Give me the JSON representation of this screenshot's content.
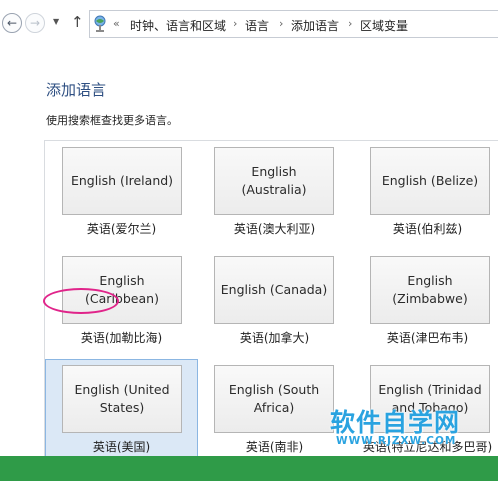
{
  "address_bar": {
    "overflow": "«",
    "crumbs": [
      "时钟、语言和区域",
      "语言",
      "添加语言",
      "区域变量"
    ],
    "separator": "›"
  },
  "page": {
    "title": "添加语言",
    "hint": "使用搜索框查找更多语言。"
  },
  "languages": [
    {
      "label": "English (Ireland)",
      "native": "英语(爱尔兰)"
    },
    {
      "label": "English (Australia)",
      "native": "英语(澳大利亚)"
    },
    {
      "label": "English (Belize)",
      "native": "英语(伯利兹)"
    },
    {
      "label": "English (Caribbean)",
      "native": "英语(加勒比海)"
    },
    {
      "label": "English (Canada)",
      "native": "英语(加拿大)"
    },
    {
      "label": "English (Zimbabwe)",
      "native": "英语(津巴布韦)"
    },
    {
      "label": "English (United States)",
      "native": "英语(美国)",
      "selected": true
    },
    {
      "label": "English (South Africa)",
      "native": "英语(南非)"
    },
    {
      "label": "English (Trinidad and Tobago)",
      "native": "英语(特立尼达和多巴哥)"
    }
  ],
  "watermark": {
    "text": "软件自学网",
    "url": "WWW.RJZXW.COM"
  },
  "colors": {
    "title": "#2e4f82",
    "selection": "#dbe8f6",
    "highlight_ring": "#e0248a",
    "watermark": "#2aa3e0",
    "bottom_bar": "#2f9b48"
  }
}
